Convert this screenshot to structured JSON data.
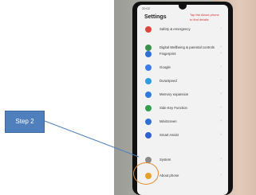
{
  "callout": {
    "label": "Step 2"
  },
  "phone": {
    "status_time": "20:02",
    "title": "Settings",
    "note_lines": [
      "Tap the About phone",
      "to find details"
    ],
    "items": [
      {
        "label": "Safety & emergency",
        "color": "#e0453a"
      },
      {
        "label": "Digital Wellbeing & parental controls",
        "color": "#3a8f4a"
      },
      {
        "label": "Fingerprint",
        "color": "#2f6fd6"
      },
      {
        "label": "Google",
        "color": "#3b7bea"
      },
      {
        "label": "DuraSpeed",
        "color": "#2f9be0"
      },
      {
        "label": "Memory expansion",
        "color": "#2e7be0"
      },
      {
        "label": "Side Key Function",
        "color": "#2ea050"
      },
      {
        "label": "MiniScreen",
        "color": "#2f6fd6"
      },
      {
        "label": "Smart Assist",
        "color": "#2f5fd0"
      },
      {
        "label": "System",
        "color": "#8a8a8a"
      },
      {
        "label": "About phone",
        "color": "#e6a02a"
      }
    ]
  },
  "colors": {
    "callout_fill": "#4f80bd",
    "highlight_ring": "#e08a2a",
    "note_text": "#d83030"
  }
}
